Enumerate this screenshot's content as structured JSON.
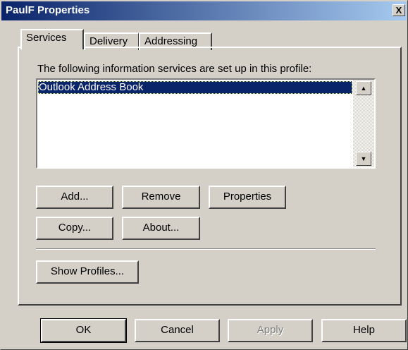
{
  "window": {
    "title": "PaulF Properties",
    "close_glyph": "X"
  },
  "tabs": [
    {
      "label": "Services",
      "active": true
    },
    {
      "label": "Delivery",
      "active": false
    },
    {
      "label": "Addressing",
      "active": false
    }
  ],
  "services": {
    "description": "The following information services are set up in this profile:",
    "items": [
      "Outlook Address Book"
    ],
    "selected_index": 0
  },
  "buttons": {
    "add": "Add...",
    "remove": "Remove",
    "properties": "Properties",
    "copy": "Copy...",
    "about": "About...",
    "show_profiles": "Show Profiles..."
  },
  "footer": {
    "ok": "OK",
    "cancel": "Cancel",
    "apply": "Apply",
    "apply_enabled": false,
    "help": "Help"
  },
  "icons": {
    "scroll_up": "scroll-up-arrow-icon",
    "scroll_down": "scroll-down-arrow-icon",
    "close": "close-icon"
  },
  "colors": {
    "titlebar_start": "#0a246a",
    "titlebar_end": "#a6caf0",
    "face": "#d4d0c8",
    "selection": "#0a246a"
  }
}
